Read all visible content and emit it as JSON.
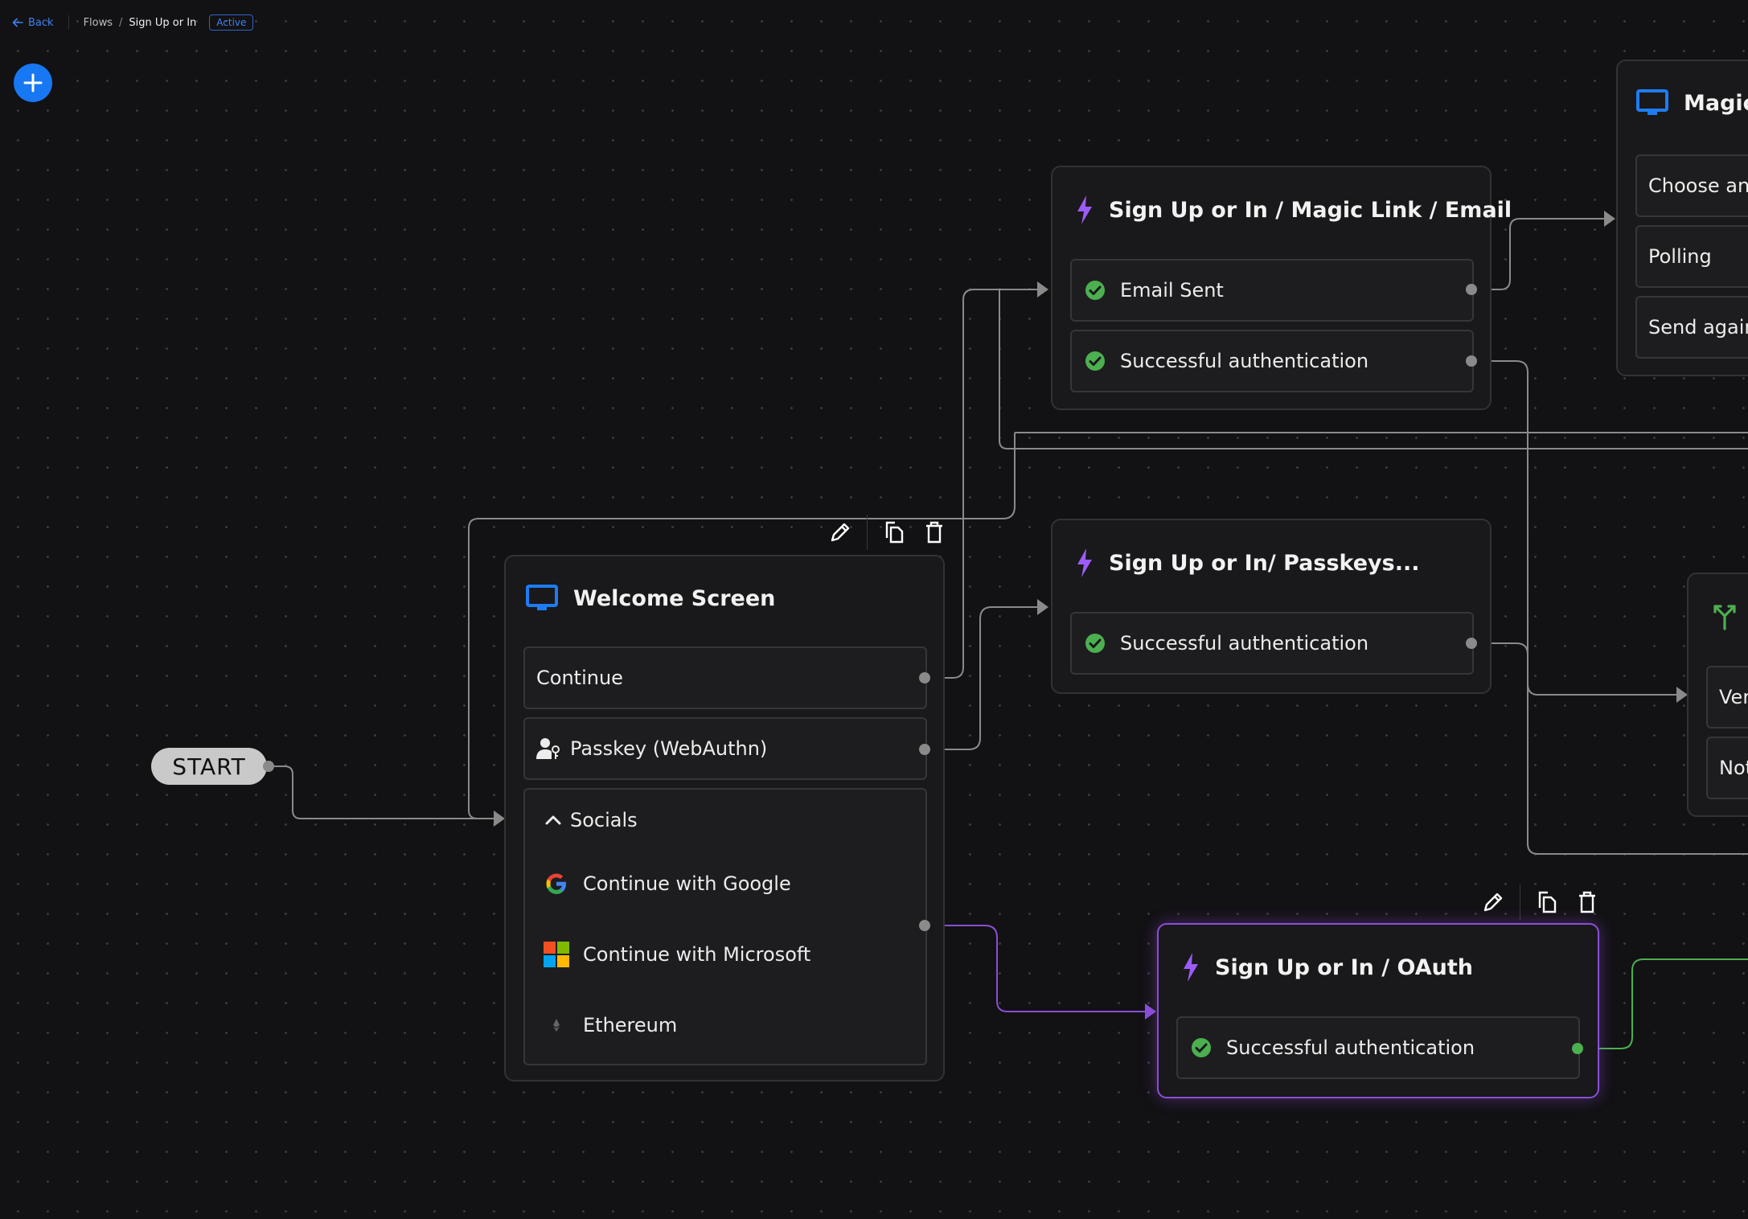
{
  "header": {
    "back_label": "Back",
    "breadcrumb_root": "Flows",
    "breadcrumb_separator": "/",
    "breadcrumb_current": "Sign Up or In",
    "status_badge": "Active"
  },
  "start_node": {
    "label": "START"
  },
  "welcome": {
    "title": "Welcome Screen",
    "continue_label": "Continue",
    "passkey_label": "Passkey (WebAuthn)",
    "socials_label": "Socials",
    "google_label": "Continue with Google",
    "microsoft_label": "Continue with Microsoft",
    "ethereum_label": "Ethereum"
  },
  "magic_link_action": {
    "title": "Sign Up or In / Magic Link / Email",
    "outputs": [
      "Email Sent",
      "Successful authentication"
    ]
  },
  "passkeys_action": {
    "title": "Sign Up or In/ Passkeys...",
    "outputs": [
      "Successful authentication"
    ]
  },
  "oauth_action": {
    "title": "Sign Up or In / OAuth",
    "outputs": [
      "Successful authentication"
    ]
  },
  "magic_screen": {
    "title": "Magic",
    "rows": [
      "Choose and",
      "Polling",
      "Send again"
    ]
  },
  "condition_node": {
    "rows": [
      "Ver",
      "Not"
    ]
  },
  "colors": {
    "background": "#121113",
    "accent_blue": "#1877f2",
    "action_purple": "#9b5cf6",
    "success_green": "#4caf50",
    "wire_gray": "#8a8a8a"
  },
  "icons": [
    "arrow-left-icon",
    "plus-icon",
    "monitor-icon",
    "lightning-icon",
    "check-circle-icon",
    "user-key-icon",
    "chevron-up-icon",
    "google-icon",
    "microsoft-icon",
    "ethereum-icon",
    "pencil-icon",
    "copy-icon",
    "trash-icon",
    "split-icon"
  ]
}
